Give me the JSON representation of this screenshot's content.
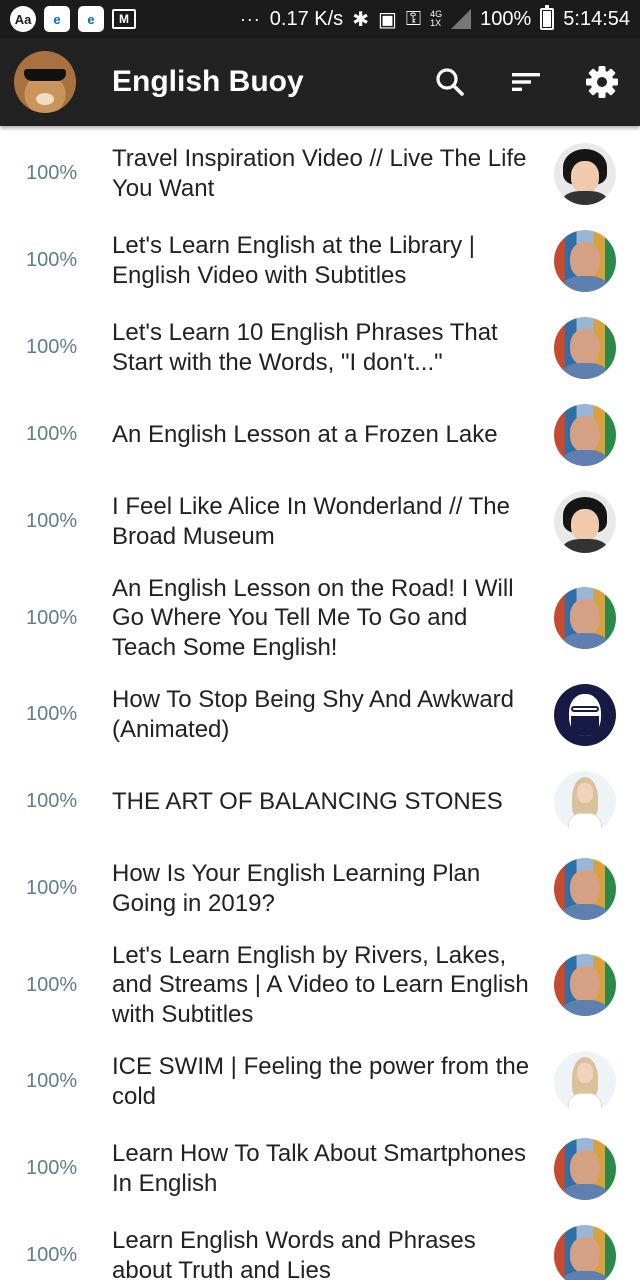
{
  "status_bar": {
    "app_icons": [
      "dictionary-icon",
      "browser-icon",
      "browser-icon",
      "gmail-icon"
    ],
    "overflow": "···",
    "net_speed": "0.17 K/s",
    "network_type": "4G",
    "sim_label": "1X",
    "battery": "100%",
    "time": "5:14:54"
  },
  "app_bar": {
    "title": "English Buoy",
    "actions": [
      "search-icon",
      "sort-icon",
      "settings-icon"
    ]
  },
  "videos": [
    {
      "progress": "100%",
      "title": "Travel Inspiration Video // Live The Life You Want",
      "channel_avatar": "woman"
    },
    {
      "progress": "100%",
      "title": "Let's Learn English at the Library | English Video with Subtitles",
      "channel_avatar": "man"
    },
    {
      "progress": "100%",
      "title": "Let's Learn 10 English Phrases That Start with the Words, \"I don't...\"",
      "channel_avatar": "man"
    },
    {
      "progress": "100%",
      "title": "An English Lesson at a Frozen Lake",
      "channel_avatar": "man"
    },
    {
      "progress": "100%",
      "title": "I Feel Like Alice In Wonderland // The Broad Museum",
      "channel_avatar": "woman"
    },
    {
      "progress": "100%",
      "title": "An English Lesson on the Road! I Will Go Where You Tell Me To Go and Teach Some English!",
      "channel_avatar": "man"
    },
    {
      "progress": "100%",
      "title": "How To Stop Being Shy And Awkward (Animated)",
      "channel_avatar": "navy"
    },
    {
      "progress": "100%",
      "title": "THE ART OF BALANCING STONES",
      "channel_avatar": "blonde"
    },
    {
      "progress": "100%",
      "title": "How Is Your English Learning Plan Going in 2019?",
      "channel_avatar": "man"
    },
    {
      "progress": "100%",
      "title": "Let's Learn English by Rivers, Lakes, and Streams | A Video to Learn English with Subtitles",
      "channel_avatar": "man"
    },
    {
      "progress": "100%",
      "title": "ICE SWIM | Feeling the power from the cold",
      "channel_avatar": "blonde"
    },
    {
      "progress": "100%",
      "title": "Learn How To Talk About Smartphones In English",
      "channel_avatar": "man"
    },
    {
      "progress": "100%",
      "title": "Learn English Words and Phrases about Truth and Lies",
      "channel_avatar": "man"
    }
  ],
  "colors": {
    "status_bar_bg": "#1b1b1b",
    "app_bar_bg": "#222222",
    "progress_text": "#607d8b",
    "title_text": "#222222"
  }
}
